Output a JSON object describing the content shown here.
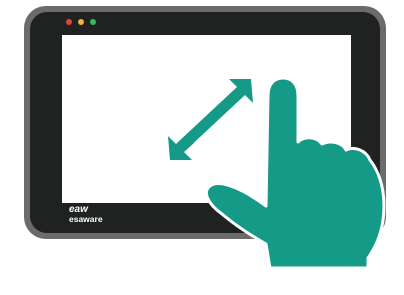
{
  "device": {
    "brand_logo": "eaw",
    "brand_name": "esaware",
    "window_dots": [
      {
        "name": "close-dot",
        "color": "#e0443a"
      },
      {
        "name": "minimize-dot",
        "color": "#f2b431"
      },
      {
        "name": "maximize-dot",
        "color": "#2fbf5a"
      }
    ],
    "bezel_color": "#1f2221",
    "frame_color": "#6b6b6b",
    "screen_color": "#ffffff"
  },
  "icons": {
    "expand": "expand-diagonal-arrows-icon",
    "hand": "pointing-hand-icon"
  },
  "colors": {
    "accent": "#149a86"
  }
}
